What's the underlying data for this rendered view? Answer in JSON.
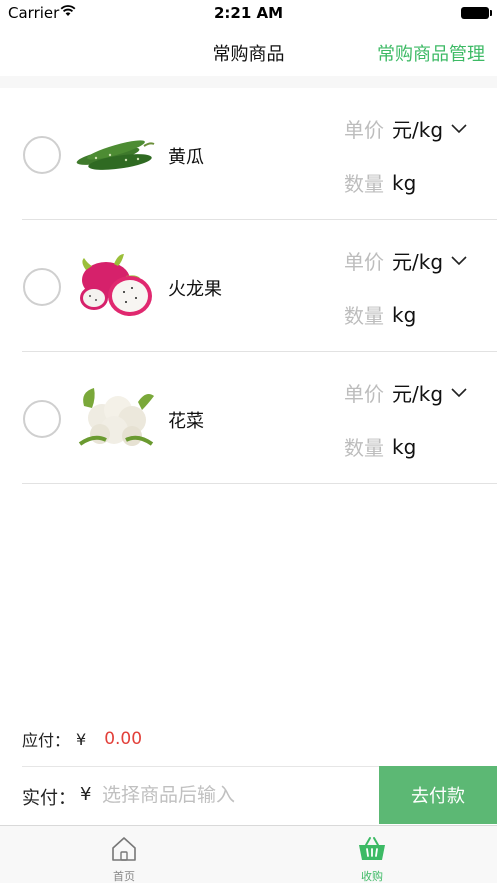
{
  "status_bar": {
    "carrier": "Carrier",
    "time": "2:21 AM"
  },
  "nav": {
    "title": "常购商品",
    "manage": "常购商品管理"
  },
  "items": [
    {
      "name": "黄瓜",
      "price_label": "单价",
      "price_unit": "元/kg",
      "qty_label": "数量",
      "qty_unit": "kg",
      "image": "cucumber-image",
      "selected": false
    },
    {
      "name": "火龙果",
      "price_label": "单价",
      "price_unit": "元/kg",
      "qty_label": "数量",
      "qty_unit": "kg",
      "image": "dragon-fruit-image",
      "selected": false
    },
    {
      "name": "花菜",
      "price_label": "单价",
      "price_unit": "元/kg",
      "qty_label": "数量",
      "qty_unit": "kg",
      "image": "cauliflower-image",
      "selected": false
    }
  ],
  "summary": {
    "due_label": "应付：",
    "currency": "¥",
    "due_value": "0.00",
    "paid_label": "实付：",
    "paid_placeholder": "选择商品后输入",
    "pay_button": "去付款"
  },
  "tabs": [
    {
      "label": "首页",
      "icon": "home-icon",
      "active": false
    },
    {
      "label": "收购",
      "icon": "basket-icon",
      "active": true
    }
  ],
  "colors": {
    "accent": "#3dba65",
    "pay_button": "#5cb874",
    "due_value": "#e2403a",
    "muted": "#bdbdbd"
  }
}
